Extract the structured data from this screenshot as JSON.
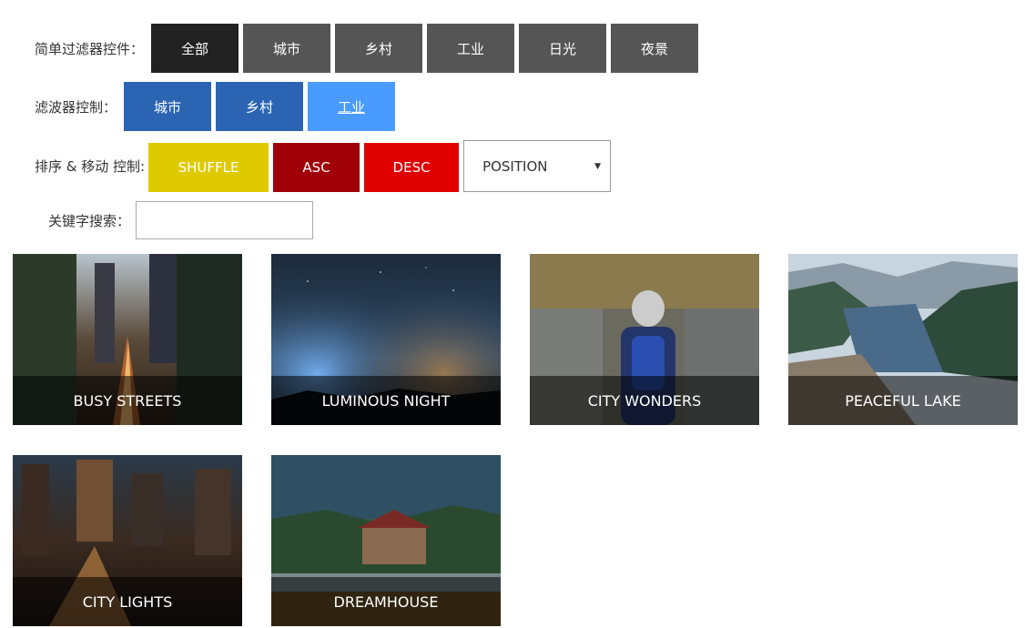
{
  "simple_filter": {
    "label": "简单过滤器控件：",
    "buttons": [
      {
        "label": "全部"
      },
      {
        "label": "城市"
      },
      {
        "label": "乡村"
      },
      {
        "label": "工业"
      },
      {
        "label": "日光"
      },
      {
        "label": "夜景"
      }
    ]
  },
  "filter_control": {
    "label": "滤波器控制：",
    "buttons": [
      {
        "label": "城市"
      },
      {
        "label": "乡村"
      },
      {
        "label": "工业"
      }
    ]
  },
  "sort_control": {
    "label": "排序 & 移动 控制:",
    "shuffle": "SHUFFLE",
    "asc": "ASC",
    "desc": "DESC",
    "select_value": "POSITION"
  },
  "search": {
    "label": "关键字搜索：",
    "value": ""
  },
  "gallery": [
    {
      "title": "BUSY STREETS"
    },
    {
      "title": "LUMINOUS NIGHT"
    },
    {
      "title": "CITY WONDERS"
    },
    {
      "title": "PEACEFUL LAKE"
    },
    {
      "title": "CITY LIGHTS"
    },
    {
      "title": "DREAMHOUSE"
    }
  ],
  "colors": {
    "gray_button": "#555555",
    "active_button": "#222222",
    "blue_button": "#2b64b3",
    "light_blue_button": "#4a9bff",
    "shuffle": "#dfca00",
    "asc": "#a00008",
    "desc": "#e00000"
  }
}
